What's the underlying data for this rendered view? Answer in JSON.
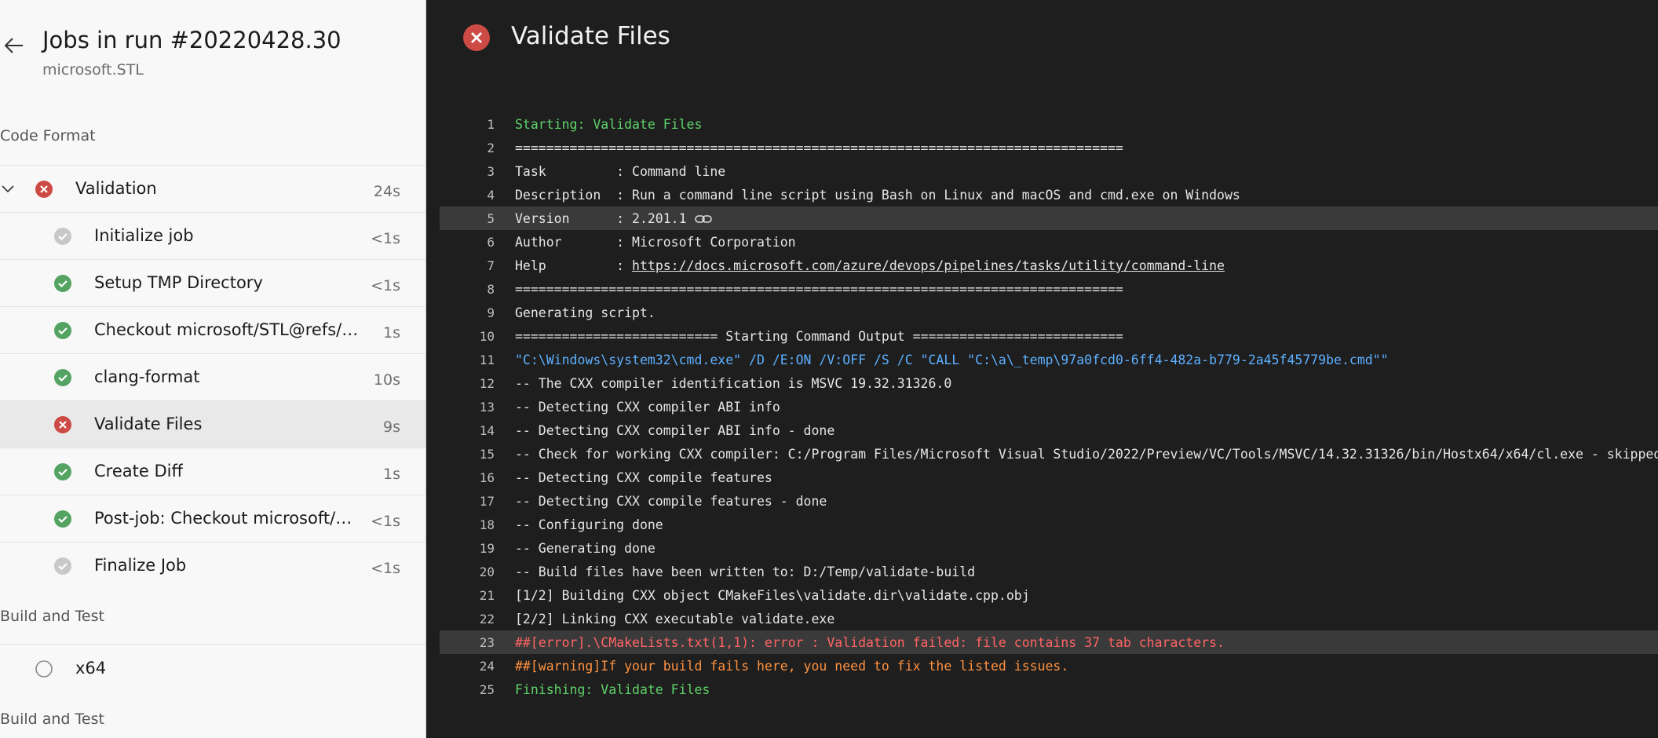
{
  "sidebar": {
    "title": "Jobs in run #20220428.30",
    "subtitle": "microsoft.STL",
    "sections": [
      {
        "label": "Code Format"
      },
      {
        "label": "Build and Test"
      },
      {
        "label": "Build and Test"
      }
    ],
    "validation_job": {
      "label": "Validation",
      "duration": "24s",
      "status": "failed"
    },
    "steps": [
      {
        "label": "Initialize job",
        "duration": "<1s",
        "status": "skipped"
      },
      {
        "label": "Setup TMP Directory",
        "duration": "<1s",
        "status": "succeeded"
      },
      {
        "label": "Checkout microsoft/STL@refs/pul...",
        "duration": "1s",
        "status": "succeeded"
      },
      {
        "label": "clang-format",
        "duration": "10s",
        "status": "succeeded"
      },
      {
        "label": "Validate Files",
        "duration": "9s",
        "status": "failed"
      },
      {
        "label": "Create Diff",
        "duration": "1s",
        "status": "succeeded"
      },
      {
        "label": "Post-job: Checkout microsoft/ST...",
        "duration": "<1s",
        "status": "succeeded"
      },
      {
        "label": "Finalize Job",
        "duration": "<1s",
        "status": "skipped"
      }
    ],
    "x64_job": {
      "label": "x64",
      "status": "pending"
    }
  },
  "main": {
    "title": "Validate Files",
    "status": "failed"
  },
  "log": [
    {
      "n": "1",
      "text": "Starting: Validate Files",
      "style": "green"
    },
    {
      "n": "2",
      "text": "==============================================================================",
      "style": ""
    },
    {
      "n": "3",
      "text": "Task         : Command line",
      "style": ""
    },
    {
      "n": "4",
      "text": "Description  : Run a command line script using Bash on Linux and macOS and cmd.exe on Windows",
      "style": ""
    },
    {
      "n": "5",
      "text": "Version      : 2.201.1",
      "style": ""
    },
    {
      "n": "6",
      "text": "Author       : Microsoft Corporation",
      "style": ""
    },
    {
      "n": "7",
      "prefix": "Help         : ",
      "link": "https://docs.microsoft.com/azure/devops/pipelines/tasks/utility/command-line",
      "style": ""
    },
    {
      "n": "8",
      "text": "==============================================================================",
      "style": ""
    },
    {
      "n": "9",
      "text": "Generating script.",
      "style": ""
    },
    {
      "n": "10",
      "text": "========================== Starting Command Output ===========================",
      "style": ""
    },
    {
      "n": "11",
      "text": "\"C:\\Windows\\system32\\cmd.exe\" /D /E:ON /V:OFF /S /C \"CALL \"C:\\a\\_temp\\97a0fcd0-6ff4-482a-b779-2a45f45779be.cmd\"\"",
      "style": "blue"
    },
    {
      "n": "12",
      "text": "-- The CXX compiler identification is MSVC 19.32.31326.0",
      "style": ""
    },
    {
      "n": "13",
      "text": "-- Detecting CXX compiler ABI info",
      "style": ""
    },
    {
      "n": "14",
      "text": "-- Detecting CXX compiler ABI info - done",
      "style": ""
    },
    {
      "n": "15",
      "text": "-- Check for working CXX compiler: C:/Program Files/Microsoft Visual Studio/2022/Preview/VC/Tools/MSVC/14.32.31326/bin/Hostx64/x64/cl.exe - skipped",
      "style": ""
    },
    {
      "n": "16",
      "text": "-- Detecting CXX compile features",
      "style": ""
    },
    {
      "n": "17",
      "text": "-- Detecting CXX compile features - done",
      "style": ""
    },
    {
      "n": "18",
      "text": "-- Configuring done",
      "style": ""
    },
    {
      "n": "19",
      "text": "-- Generating done",
      "style": ""
    },
    {
      "n": "20",
      "text": "-- Build files have been written to: D:/Temp/validate-build",
      "style": ""
    },
    {
      "n": "21",
      "text": "[1/2] Building CXX object CMakeFiles\\validate.dir\\validate.cpp.obj",
      "style": ""
    },
    {
      "n": "22",
      "text": "[2/2] Linking CXX executable validate.exe",
      "style": ""
    },
    {
      "n": "23",
      "text": "##[error].\\CMakeLists.txt(1,1): error : Validation failed: file contains 37 tab characters.",
      "style": "red"
    },
    {
      "n": "24",
      "text": "##[warning]If your build fails here, you need to fix the listed issues.",
      "style": "orange"
    },
    {
      "n": "25",
      "text": "Finishing: Validate Files",
      "style": "green"
    }
  ],
  "highlighted_lines": [
    "5",
    "23"
  ],
  "colors": {
    "success": "#55a362",
    "failed": "#cd4a45",
    "skipped": "#c8c8c8",
    "log_green": "#5fd36a",
    "log_blue": "#5db0ff",
    "log_red": "#ff6464",
    "log_orange": "#ff9240"
  }
}
